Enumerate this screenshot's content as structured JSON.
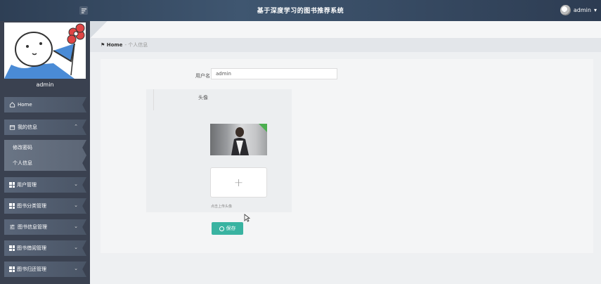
{
  "header": {
    "title": "基于深度学习的图书推荐系统",
    "user": "admin",
    "user_caret": "▾"
  },
  "sidebar": {
    "username": "admin",
    "items": [
      {
        "label": "Home",
        "icon": "home-icon"
      },
      {
        "label": "我的信息",
        "icon": "calendar-icon",
        "chevron": "⌃"
      },
      {
        "label": "修改密码",
        "sub": true
      },
      {
        "label": "个人信息",
        "sub": true
      },
      {
        "label": "用户管理",
        "icon": "grid-icon",
        "chevron": "⌄"
      },
      {
        "label": "图书分类管理",
        "icon": "grid-icon",
        "chevron": "⌄"
      },
      {
        "label": "图书信息管理",
        "icon": "sliders-icon",
        "chevron": "⌄"
      },
      {
        "label": "图书借阅管理",
        "icon": "grid-icon",
        "chevron": "⌄"
      },
      {
        "label": "图书归还管理",
        "icon": "grid-icon",
        "chevron": "⌄"
      }
    ]
  },
  "breadcrumb": {
    "home": "Home",
    "separator": "-",
    "current": "个人信息"
  },
  "form": {
    "username_label": "用户名",
    "username_value": "admin",
    "avatar_label": "头像",
    "upload_plus": "+",
    "upload_hint": "点击上传头像",
    "save_label": "保存"
  },
  "colors": {
    "topbar": "#3f5670",
    "sidebar": "#3a4150",
    "save_button": "#39b3a1"
  }
}
